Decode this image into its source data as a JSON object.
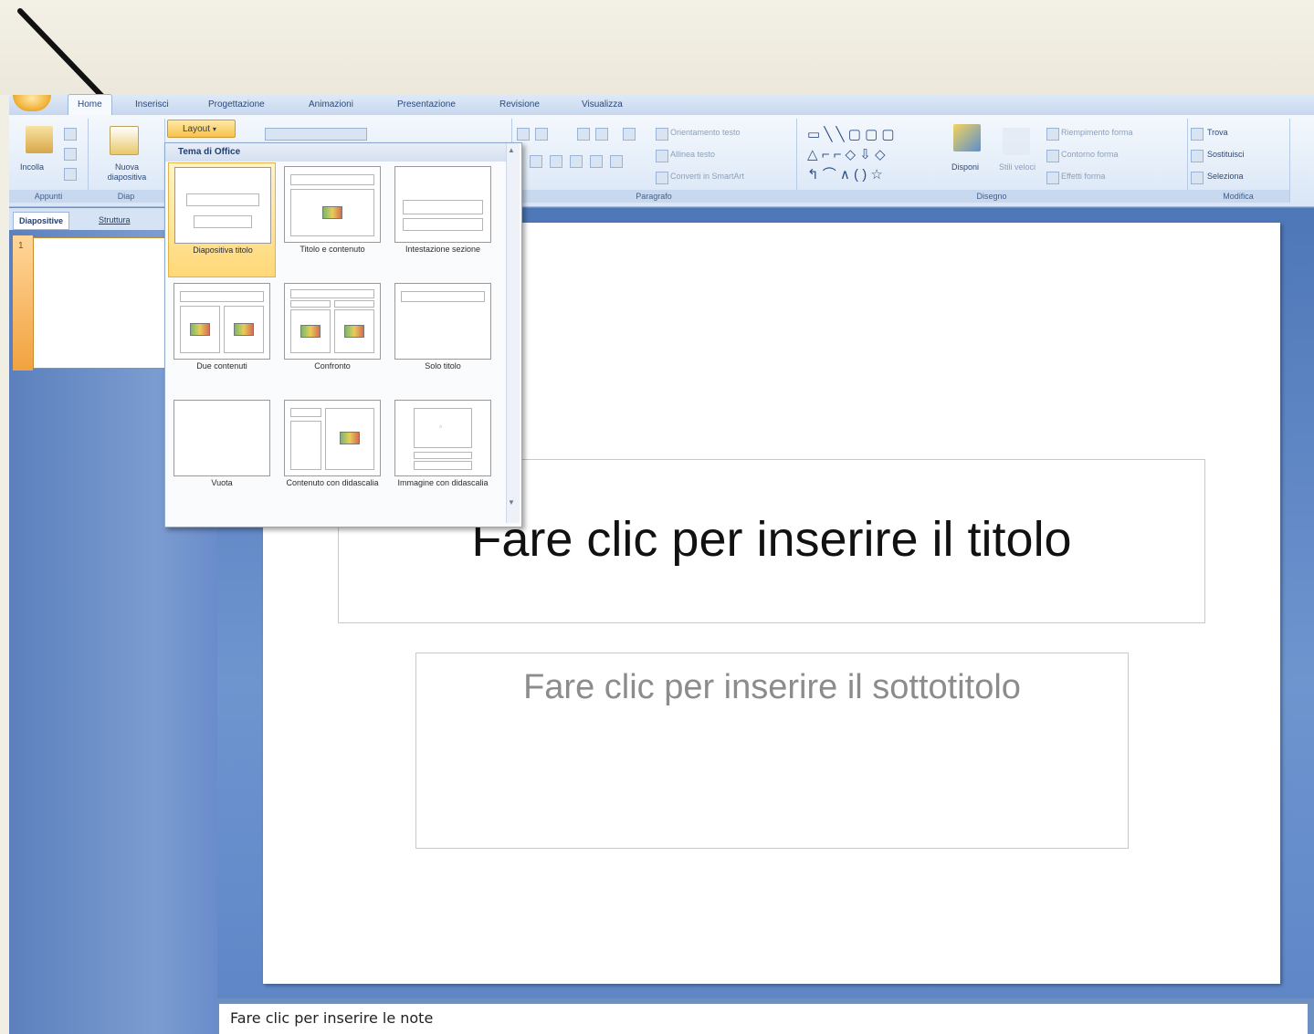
{
  "ribbon": {
    "tabs": [
      "Home",
      "Inserisci",
      "Progettazione",
      "Animazioni",
      "Presentazione",
      "Revisione",
      "Visualizza"
    ],
    "active_tab": "Home",
    "clipboard": {
      "paste_label": "Incolla",
      "group_label": "Appunti"
    },
    "slides": {
      "new_slide_label": "Nuova diapositiva",
      "layout_label": "Layout",
      "group_label": "Diap"
    },
    "paragraph": {
      "group_label": "Paragrafo",
      "text_direction": "Orientamento testo",
      "align_text": "Allinea testo",
      "smartart": "Converti in SmartArt"
    },
    "drawing": {
      "group_label": "Disegno",
      "arrange_label": "Disponi",
      "quick_styles_label": "Stili veloci",
      "shape_fill": "Riempimento forma",
      "shape_outline": "Contorno forma",
      "shape_effects": "Effetti forma"
    },
    "editing": {
      "group_label": "Modifica",
      "find": "Trova",
      "replace": "Sostituisci",
      "select": "Seleziona"
    }
  },
  "left_pane": {
    "tabs": [
      "Diapositive",
      "Struttura"
    ],
    "slide_number": "1"
  },
  "gallery": {
    "title": "Tema di Office",
    "layouts": [
      {
        "label": "Diapositiva titolo",
        "selected": true
      },
      {
        "label": "Titolo e contenuto",
        "selected": false
      },
      {
        "label": "Intestazione sezione",
        "selected": false
      },
      {
        "label": "Due contenuti",
        "selected": false
      },
      {
        "label": "Confronto",
        "selected": false
      },
      {
        "label": "Solo titolo",
        "selected": false
      },
      {
        "label": "Vuota",
        "selected": false
      },
      {
        "label": "Contenuto con didascalia",
        "selected": false
      },
      {
        "label": "Immagine con didascalia",
        "selected": false
      }
    ]
  },
  "slide": {
    "title_placeholder": "Fare clic per inserire il titolo",
    "subtitle_placeholder": "Fare clic per inserire il sottotitolo"
  },
  "notes": {
    "placeholder": "Fare clic per inserire le note"
  },
  "colors": {
    "ribbon_blue": "#c6d7ee",
    "workspace_blue": "#5f87c8",
    "selection_gold": "#ffd877",
    "office_orange": "#f2b33a"
  },
  "annotation": {
    "icon": "pointer-arrow-icon"
  }
}
